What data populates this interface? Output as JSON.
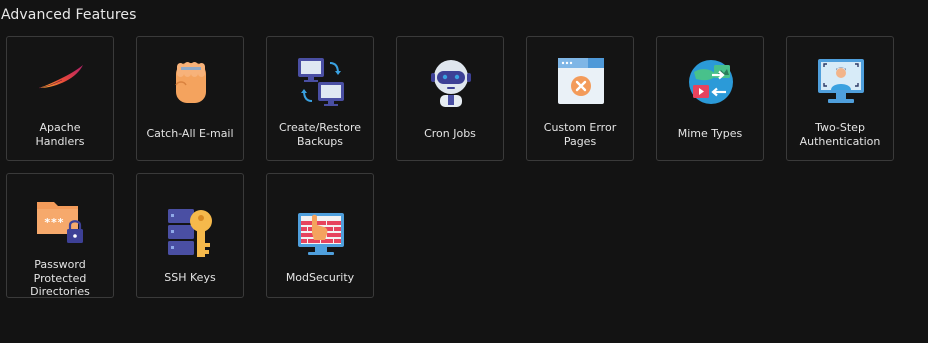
{
  "section": {
    "title": "Advanced Features"
  },
  "tiles": [
    {
      "label": "Apache\nHandlers",
      "icon": "feather-icon"
    },
    {
      "label": "Catch-All E-mail",
      "icon": "fist-icon"
    },
    {
      "label": "Create/Restore\nBackups",
      "icon": "backup-monitors-icon"
    },
    {
      "label": "Cron Jobs",
      "icon": "robot-icon"
    },
    {
      "label": "Custom Error\nPages",
      "icon": "error-page-icon"
    },
    {
      "label": "Mime Types",
      "icon": "globe-media-icon"
    },
    {
      "label": "Two-Step\nAuthentication",
      "icon": "monitor-user-icon"
    },
    {
      "label": "Password\nProtected\nDirectories",
      "icon": "locked-folder-icon"
    },
    {
      "label": "SSH Keys",
      "icon": "server-key-icon"
    },
    {
      "label": "ModSecurity",
      "icon": "firewall-hand-icon"
    }
  ]
}
